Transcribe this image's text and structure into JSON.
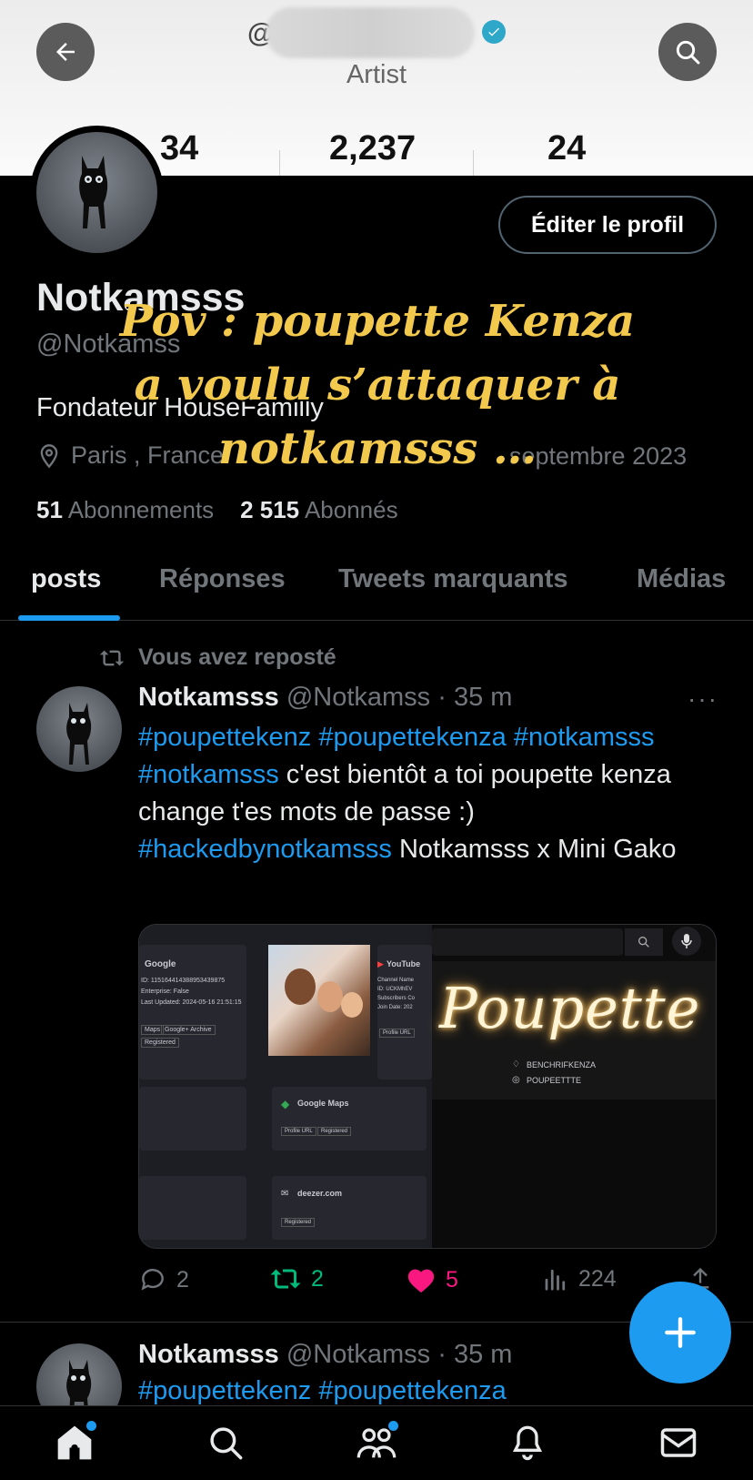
{
  "header": {
    "handle_prefix": "@",
    "subtitle": "Artist",
    "stats": [
      "34",
      "2,237",
      "24"
    ]
  },
  "profile": {
    "edit_button": "Éditer le profil",
    "name": "Notkamsss",
    "username": "@Notkamss",
    "bio": "Fondateur HouseFamilly",
    "location": "Paris , France",
    "joined": "septembre 2023",
    "following_count": "51",
    "following_label": "Abonnements",
    "followers_count": "2 515",
    "followers_label": "Abonnés"
  },
  "overlay_caption": "Pov : poupette Kenza a voulu s’attaquer à notkamsss …",
  "tabs": [
    {
      "label": "posts",
      "active": true
    },
    {
      "label": "Réponses",
      "active": false
    },
    {
      "label": "Tweets marquants",
      "active": false
    },
    {
      "label": "Médias",
      "active": false
    }
  ],
  "tweet": {
    "repost_label": "Vous avez reposté",
    "author": "Notkamsss",
    "handle": "@Notkamss",
    "time": "· 35 m",
    "more": "···",
    "tag1": "#poupettekenz",
    "tag2": "#poupettekenza",
    "tag3": "#notkamsss",
    "tag4": "#notkamsss",
    "text1": "c'est bientôt a toi poupette kenza change t'es mots de passe :)",
    "tag5": "#hackedbynotkamsss",
    "text2": "Notkamsss x Mini Gako",
    "media": {
      "google": "Google",
      "google_id": "ID: 115164414388953439875",
      "google_ent": "Enterprise: False",
      "google_upd": "Last Updated: 2024-05-16 21:51:15",
      "btn_maps": "Maps",
      "btn_archive": "Google+ Archive",
      "btn_registered": "Registered",
      "youtube": "YouTube",
      "yt_channel": "Channel Name",
      "yt_id": "ID: UCKMhEV",
      "yt_subs": "Subscribers Co",
      "yt_join": "Join Date: 202",
      "btn_profile": "Profile URL",
      "gmaps": "Google Maps",
      "deezer": "deezer.com",
      "neon": "Poupette",
      "snap": "BENCHRIFKENZA",
      "insta": "POUPEETTTE"
    },
    "replies": "2",
    "reposts": "2",
    "likes": "5",
    "views": "224",
    "colors": {
      "repost": "#00ba7c",
      "like": "#f91880",
      "accent": "#1d9bf0"
    }
  },
  "tweet2": {
    "author": "Notkamsss",
    "handle": "@Notkamss",
    "time": "· 35 m",
    "tags": "#poupettekenz #poupettekenza"
  }
}
